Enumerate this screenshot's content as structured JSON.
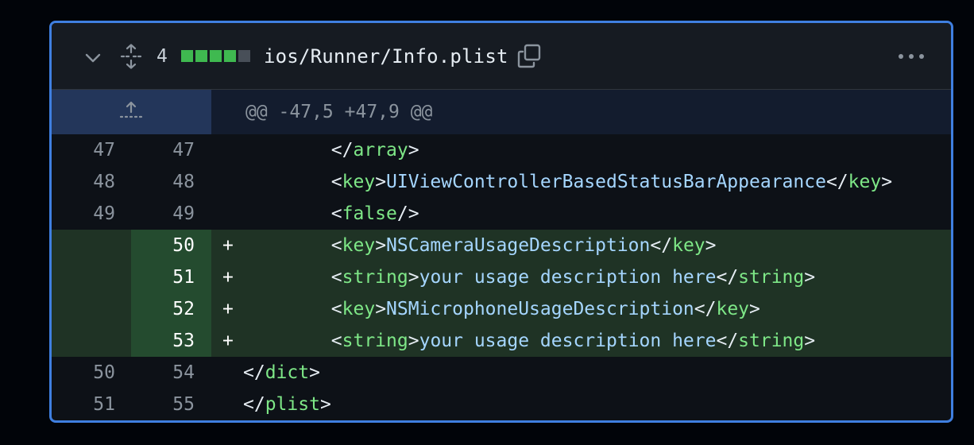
{
  "file": {
    "change_count": "4",
    "diffstat": [
      "add",
      "add",
      "add",
      "add",
      "neutral"
    ],
    "path": "ios/Runner/Info.plist",
    "colors": {
      "border": "#3f7fe0",
      "added_bg": "#1f3325",
      "tag": "#7ee787",
      "text": "#a5d6ff"
    }
  },
  "hunk": {
    "header": "@@ -47,5 +47,9 @@"
  },
  "lines": [
    {
      "old": "47",
      "new": "47",
      "sign": "",
      "indent": "        ",
      "parts": [
        [
          "punc",
          "</"
        ],
        [
          "tag",
          "array"
        ],
        [
          "punc",
          ">"
        ]
      ]
    },
    {
      "old": "48",
      "new": "48",
      "sign": "",
      "indent": "        ",
      "parts": [
        [
          "punc",
          "<"
        ],
        [
          "tag",
          "key"
        ],
        [
          "punc",
          ">"
        ],
        [
          "name",
          "UIViewControllerBasedStatusBarAppearance"
        ],
        [
          "punc",
          "</"
        ],
        [
          "tag",
          "key"
        ],
        [
          "punc",
          ">"
        ]
      ]
    },
    {
      "old": "49",
      "new": "49",
      "sign": "",
      "indent": "        ",
      "parts": [
        [
          "punc",
          "<"
        ],
        [
          "tag",
          "false"
        ],
        [
          "punc",
          "/>"
        ]
      ]
    },
    {
      "old": "",
      "new": "50",
      "sign": "+",
      "indent": "        ",
      "parts": [
        [
          "punc",
          "<"
        ],
        [
          "tag",
          "key"
        ],
        [
          "punc",
          ">"
        ],
        [
          "name",
          "NSCameraUsageDescription"
        ],
        [
          "punc",
          "</"
        ],
        [
          "tag",
          "key"
        ],
        [
          "punc",
          ">"
        ]
      ]
    },
    {
      "old": "",
      "new": "51",
      "sign": "+",
      "indent": "        ",
      "parts": [
        [
          "punc",
          "<"
        ],
        [
          "tag",
          "string"
        ],
        [
          "punc",
          ">"
        ],
        [
          "name",
          "your usage description here"
        ],
        [
          "punc",
          "</"
        ],
        [
          "tag",
          "string"
        ],
        [
          "punc",
          ">"
        ]
      ]
    },
    {
      "old": "",
      "new": "52",
      "sign": "+",
      "indent": "        ",
      "parts": [
        [
          "punc",
          "<"
        ],
        [
          "tag",
          "key"
        ],
        [
          "punc",
          ">"
        ],
        [
          "name",
          "NSMicrophoneUsageDescription"
        ],
        [
          "punc",
          "</"
        ],
        [
          "tag",
          "key"
        ],
        [
          "punc",
          ">"
        ]
      ]
    },
    {
      "old": "",
      "new": "53",
      "sign": "+",
      "indent": "        ",
      "parts": [
        [
          "punc",
          "<"
        ],
        [
          "tag",
          "string"
        ],
        [
          "punc",
          ">"
        ],
        [
          "name",
          "your usage description here"
        ],
        [
          "punc",
          "</"
        ],
        [
          "tag",
          "string"
        ],
        [
          "punc",
          ">"
        ]
      ]
    },
    {
      "old": "50",
      "new": "54",
      "sign": "",
      "indent": "",
      "parts": [
        [
          "punc",
          "</"
        ],
        [
          "tag",
          "dict"
        ],
        [
          "punc",
          ">"
        ]
      ]
    },
    {
      "old": "51",
      "new": "55",
      "sign": "",
      "indent": "",
      "parts": [
        [
          "punc",
          "</"
        ],
        [
          "tag",
          "plist"
        ],
        [
          "punc",
          ">"
        ]
      ]
    }
  ]
}
